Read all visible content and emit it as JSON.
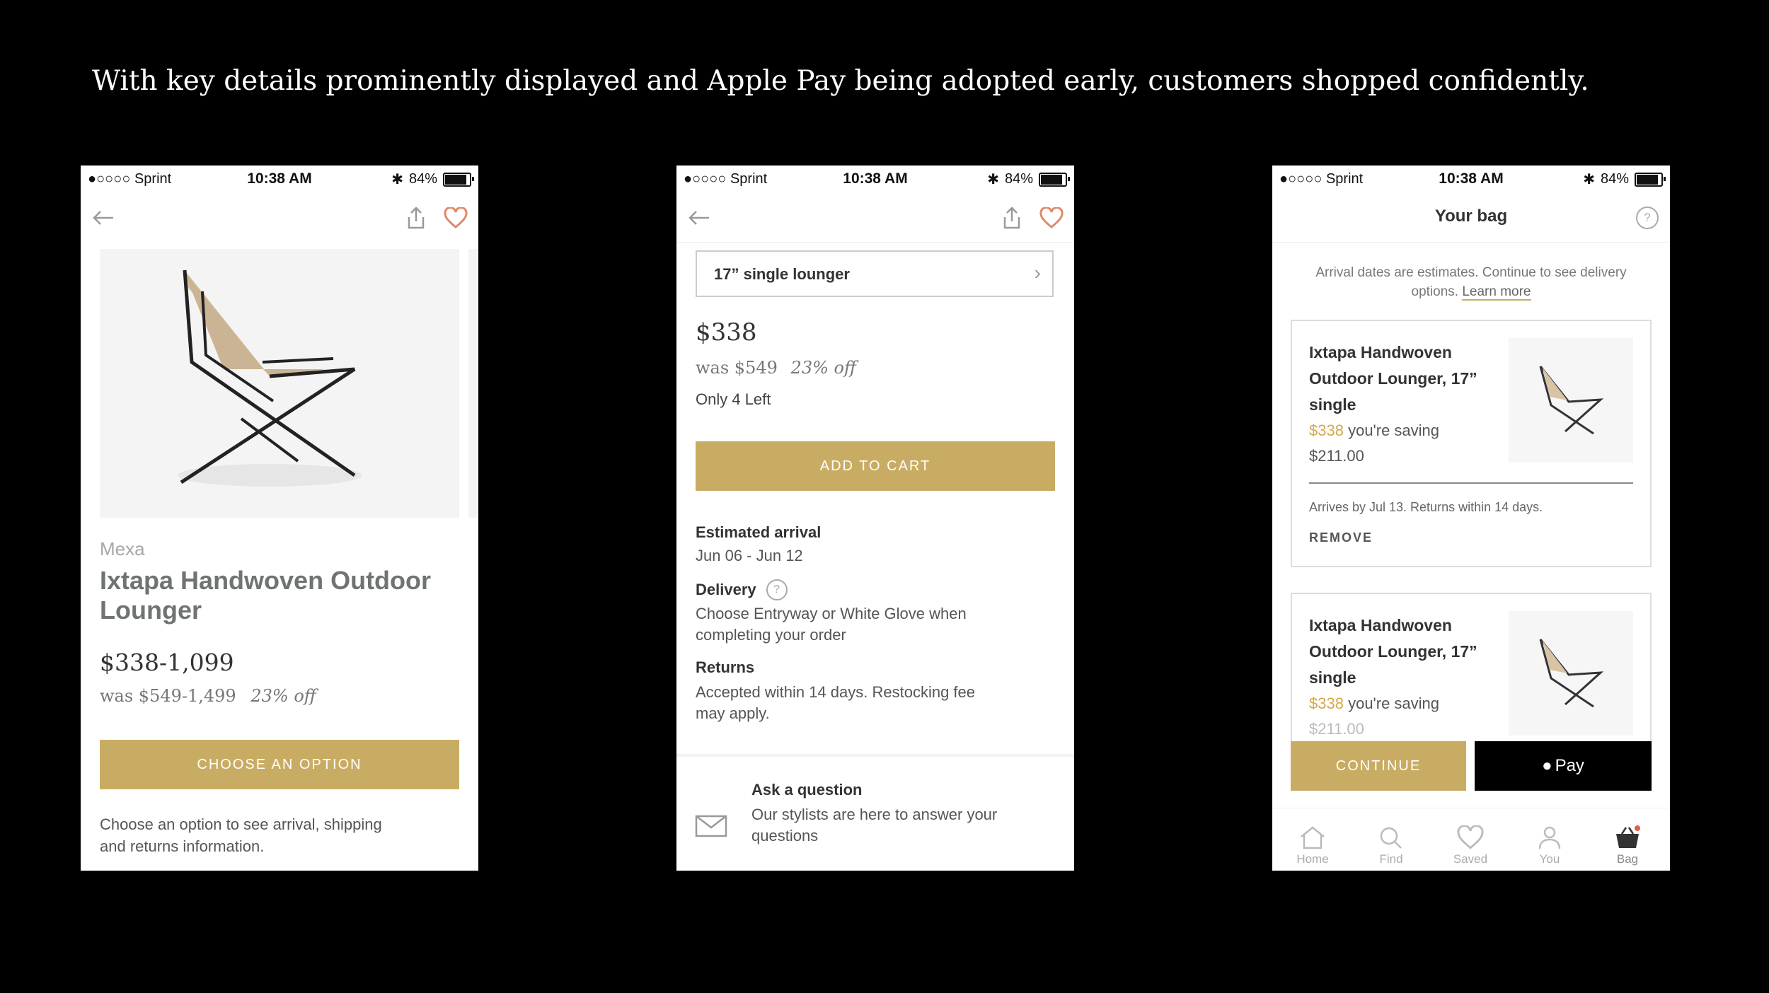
{
  "headline": "With key details prominently displayed and Apple Pay being adopted early, customers shopped confidently.",
  "status": {
    "carrier": "●○○○○ Sprint",
    "time": "10:38 AM",
    "battery": "84%"
  },
  "screen1": {
    "brand": "Mexa",
    "title": "Ixtapa Handwoven Outdoor Lounger",
    "price": "$338-1,099",
    "was": "was $549-1,499",
    "discount": "23% off",
    "cta": "CHOOSE AN OPTION",
    "note": "Choose an option to see arrival, shipping and returns information."
  },
  "screen2": {
    "option": "17” single lounger",
    "price": "$338",
    "was": "was $549",
    "discount": "23% off",
    "stock": "Only 4 Left",
    "cta": "ADD TO CART",
    "arrival_label": "Estimated arrival",
    "arrival_value": "Jun 06 - Jun 12",
    "delivery_label": "Delivery",
    "delivery_value": "Choose Entryway or White Glove when completing your order",
    "returns_label": "Returns",
    "returns_value": "Accepted within 14 days. Restocking fee may apply.",
    "ask_title": "Ask a question",
    "ask_body": "Our stylists are here to answer your questions"
  },
  "screen3": {
    "title": "Your bag",
    "notice": "Arrival dates are estimates. Continue to see delivery options.",
    "learn_more": "Learn more",
    "item_name": "Ixtapa Handwoven Outdoor Lounger, 17” single",
    "item_price": "$338",
    "saving_label": "you're saving",
    "saving_value": "$211.00",
    "arrives": "Arrives by Jul 13. Returns within 14 days.",
    "remove": "REMOVE",
    "continue": "CONTINUE",
    "apple_pay": "Pay",
    "tabs": [
      "Home",
      "Find",
      "Saved",
      "You",
      "Bag"
    ]
  },
  "colors": {
    "gold": "#c9ac63",
    "heart": "#e0896a",
    "price_gold": "#d4a94a"
  }
}
